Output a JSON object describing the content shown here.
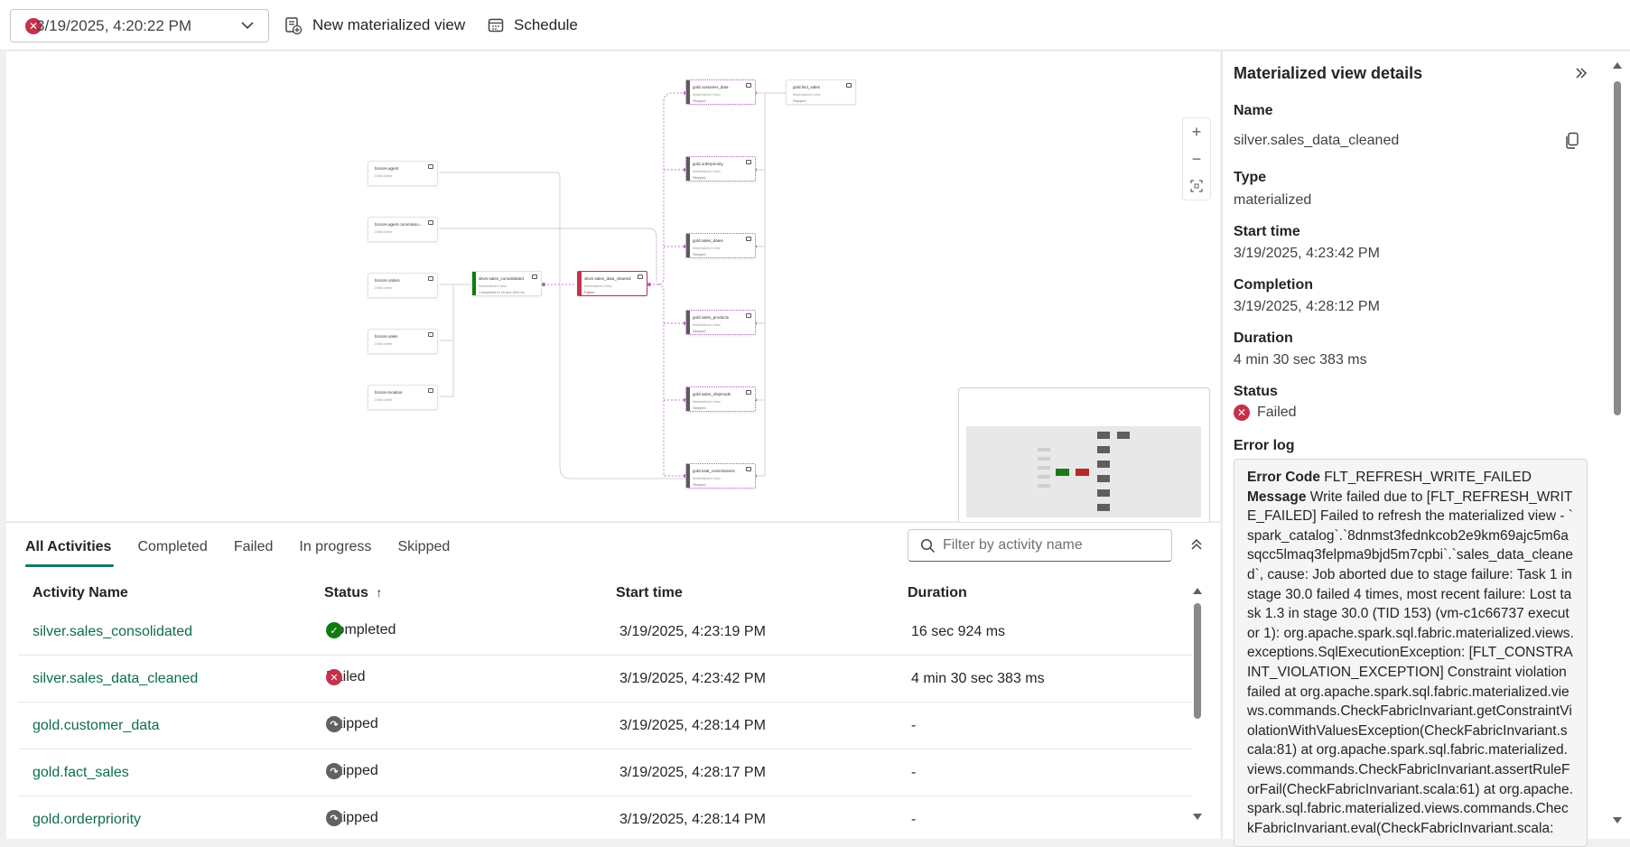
{
  "toolbar": {
    "run_selector_value": "3/19/2025, 4:20:22 PM",
    "new_mv_label": "New materialized view",
    "schedule_label": "Schedule"
  },
  "graph": {
    "zoom_in": "+",
    "zoom_out": "−",
    "nodes": {
      "bronze_agent": {
        "title": "bronze.agent",
        "subtitle": "Delta table"
      },
      "bronze_agent_comm": {
        "title": "bronze.agent commissio...",
        "subtitle": "Delta table"
      },
      "bronze_orders": {
        "title": "bronze.orders",
        "subtitle": "Delta table"
      },
      "bronze_sales": {
        "title": "bronze.sales",
        "subtitle": "Delta table"
      },
      "bronze_location": {
        "title": "bronze.location",
        "subtitle": "Delta table"
      },
      "silver_consolidated": {
        "title": "silver.sales_consolidated",
        "subtitle": "Materialized view",
        "status": "Completed in 16 sec 924 ms"
      },
      "silver_cleaned": {
        "title": "silver.sales_data_cleaned",
        "subtitle": "Materialized view",
        "status": "Failed"
      },
      "gold_customer": {
        "title": "gold.customer_data",
        "subtitle": "Materialized view",
        "status": "Skipped"
      },
      "gold_fact": {
        "title": "gold.fact_sales",
        "subtitle": "Materialized view",
        "status": "Skipped"
      },
      "gold_orderpriority": {
        "title": "gold.orderpriority",
        "subtitle": "Materialized view",
        "status": "Skipped"
      },
      "gold_dates": {
        "title": "gold.sales_dates",
        "subtitle": "Materialized view",
        "status": "Skipped"
      },
      "gold_products": {
        "title": "gold.sales_products",
        "subtitle": "Materialized view",
        "status": "Skipped"
      },
      "gold_shipmode": {
        "title": "gold.sales_shipmode",
        "subtitle": "Materialized view",
        "status": "Skipped"
      },
      "gold_commissions": {
        "title": "gold.total_commissions",
        "subtitle": "Materialized view",
        "status": "Skipped"
      }
    }
  },
  "activities": {
    "tabs": [
      "All Activities",
      "Completed",
      "Failed",
      "In progress",
      "Skipped"
    ],
    "filter_placeholder": "Filter by activity name",
    "columns": {
      "name": "Activity Name",
      "status": "Status",
      "start": "Start time",
      "duration": "Duration"
    },
    "rows": [
      {
        "name": "silver.sales_consolidated",
        "status": "Completed",
        "start": "3/19/2025, 4:23:19 PM",
        "duration": "16 sec 924 ms"
      },
      {
        "name": "silver.sales_data_cleaned",
        "status": "Failed",
        "start": "3/19/2025, 4:23:42 PM",
        "duration": "4 min 30 sec 383 ms"
      },
      {
        "name": "gold.customer_data",
        "status": "Skipped",
        "start": "3/19/2025, 4:28:14 PM",
        "duration": "-"
      },
      {
        "name": "gold.fact_sales",
        "status": "Skipped",
        "start": "3/19/2025, 4:28:17 PM",
        "duration": "-"
      },
      {
        "name": "gold.orderpriority",
        "status": "Skipped",
        "start": "3/19/2025, 4:28:14 PM",
        "duration": "-"
      }
    ]
  },
  "details": {
    "title": "Materialized view details",
    "name_label": "Name",
    "name_value": "silver.sales_data_cleaned",
    "type_label": "Type",
    "type_value": "materialized",
    "start_label": "Start time",
    "start_value": "3/19/2025, 4:23:42 PM",
    "completion_label": "Completion",
    "completion_value": "3/19/2025, 4:28:12 PM",
    "duration_label": "Duration",
    "duration_value": "4 min 30 sec 383 ms",
    "status_label": "Status",
    "status_value": "Failed",
    "error_log_label": "Error log",
    "error_code_label": "Error Code",
    "error_code_value": "FLT_REFRESH_WRITE_FAILED",
    "message_label": "Message",
    "message_value": "Write failed due to [FLT_REFRESH_WRITE_FAILED] Failed to refresh the materialized view - `spark_catalog`.`8dnmst3fednkcob2e9km69ajc5m6asqcc5lmaq3felpma9bjd5m7cpbi`.`sales_data_cleaned`, cause: Job aborted due to stage failure: Task 1 in stage 30.0 failed 4 times, most recent failure: Lost task 1.3 in stage 30.0 (TID 153) (vm-c1c66737 executor 1): org.apache.spark.sql.fabric.materialized.views.exceptions.SqlExecutionException: [FLT_CONSTRAINT_VIOLATION_EXCEPTION] Constraint violation failed at org.apache.spark.sql.fabric.materialized.views.commands.CheckFabricInvariant.getConstraintViolationWithValuesException(CheckFabricInvariant.scala:81) at org.apache.spark.sql.fabric.materialized.views.commands.CheckFabricInvariant.assertRuleForFail(CheckFabricInvariant.scala:61) at org.apache.spark.sql.fabric.materialized.views.commands.CheckFabricInvariant.eval(CheckFabricInvariant.scala:"
  },
  "colors": {
    "accent": "#117865",
    "link": "#0f6c4f",
    "failed": "#c4314b",
    "completed": "#107c10",
    "skipped": "#616161"
  }
}
